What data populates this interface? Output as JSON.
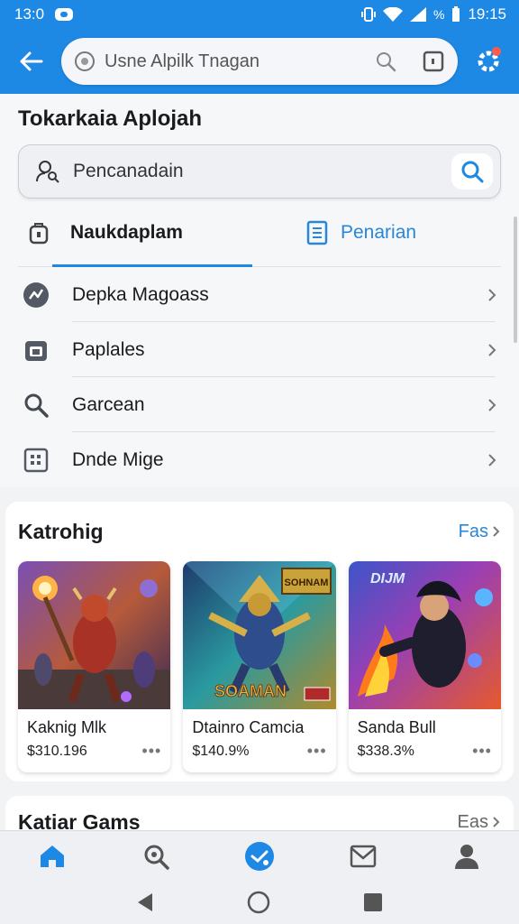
{
  "status_bar": {
    "time_left": "13:0",
    "time_right": "19:15",
    "battery_pct": "%"
  },
  "app_bar": {
    "url_text": "Usne Alpilk Tnagan"
  },
  "page": {
    "title": "Tokarkaia Aplojah"
  },
  "search": {
    "value": "Pencanadain"
  },
  "tabs": [
    {
      "label": "Naukdaplam",
      "active": true
    },
    {
      "label": "Penarian",
      "active": false
    }
  ],
  "menu": [
    {
      "label": "Depka Magoass",
      "icon": "chart-circle-icon"
    },
    {
      "label": "Paplales",
      "icon": "camera-icon"
    },
    {
      "label": "Garcean",
      "icon": "search-icon"
    },
    {
      "label": "Dnde Mige",
      "icon": "grid-icon"
    }
  ],
  "section_1": {
    "title": "Katrohig",
    "link": "Fas",
    "cards": [
      {
        "name": "Kaknig Mlk",
        "price": "$310.196",
        "dots": "•••",
        "art": "armored red warrior with staff"
      },
      {
        "name": "Dtainro Camcia",
        "price": "$140.9%",
        "dots": "•••",
        "art": "golden armored hero",
        "art_text_top": "SOHNAM",
        "art_text_bottom": "SOAMAN"
      },
      {
        "name": "Sanda Bull",
        "price": "$338.3%",
        "dots": "•••",
        "art": "dark ninja with fire",
        "art_text_top": "DIJM"
      }
    ]
  },
  "section_2": {
    "title": "Katiar Gams",
    "link": "Eas"
  },
  "colors": {
    "primary": "#1e88e5",
    "accent_text": "#2a86d6",
    "notification": "#ff5a4e"
  }
}
